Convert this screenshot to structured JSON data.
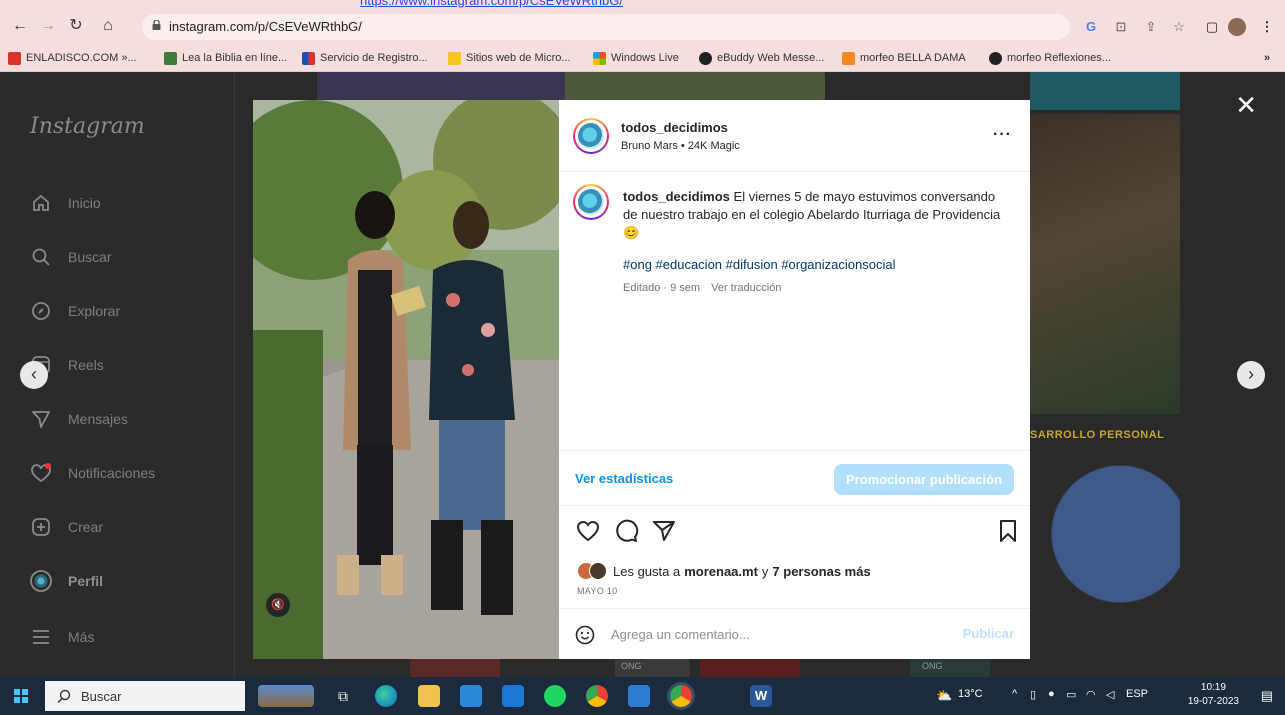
{
  "browser": {
    "top_link_fragment": "https://www.instagram.com/p/CsEVeWRthbG/",
    "url": "instagram.com/p/CsEVeWRthbG/",
    "bookmarks": [
      {
        "label": "ENLADISCO.COM »...",
        "color": "#d9342b"
      },
      {
        "label": "Lea la Biblia en líne...",
        "color": "#3f7b3a"
      },
      {
        "label": "Servicio de Registro...",
        "color": "#1d4fb8"
      },
      {
        "label": "Sitios web de Micro...",
        "color": "#f3c623"
      },
      {
        "label": "Windows Live",
        "color": "#f25022"
      },
      {
        "label": "eBuddy Web Messe...",
        "color": "#222222"
      },
      {
        "label": "morfeo BELLA DAMA",
        "color": "#f08a1c"
      },
      {
        "label": "morfeo Reflexiones...",
        "color": "#222222"
      }
    ],
    "bookmarks_more": "»"
  },
  "sidebar": {
    "logo": "Instagram",
    "items": [
      {
        "label": "Inicio",
        "icon": "home-icon"
      },
      {
        "label": "Buscar",
        "icon": "search-icon"
      },
      {
        "label": "Explorar",
        "icon": "compass-icon"
      },
      {
        "label": "Reels",
        "icon": "reels-icon"
      },
      {
        "label": "Mensajes",
        "icon": "send-icon"
      },
      {
        "label": "Notificaciones",
        "icon": "heart-icon"
      },
      {
        "label": "Crear",
        "icon": "plus-square-icon"
      },
      {
        "label": "Perfil",
        "icon": "avatar-icon"
      },
      {
        "label": "Más",
        "icon": "menu-icon"
      }
    ]
  },
  "background_tiles": {
    "developer_title": "SARROLLO PERSONAL",
    "ong_label_1": "ONG",
    "ong_label_2": "ONG"
  },
  "post": {
    "username": "todos_decidimos",
    "audio": "Bruno Mars • 24K Magic",
    "caption_user": "todos_decidimos",
    "caption_text": " El viernes 5 de mayo estuvimos conversando de nuestro trabajo en el colegio Abelardo Iturriaga de Providencia 😊",
    "hashtags": "#ong #educacion #difusion #organizacionsocial",
    "edited": "Editado · 9 sem",
    "translate": "Ver traducción",
    "stats_link": "Ver estadísticas",
    "promote": "Promocionar publicación",
    "likes_prefix": "Les gusta a ",
    "likes_user": "morenaa.mt",
    "likes_suffix": " y ",
    "likes_others": "7 personas más",
    "date": "MAYO 10",
    "comment_placeholder": "Agrega un comentario...",
    "publish": "Publicar"
  },
  "taskbar": {
    "search_placeholder": "Buscar",
    "weather": "13°C",
    "lang": "ESP",
    "time": "10:19",
    "date": "19-07-2023"
  }
}
